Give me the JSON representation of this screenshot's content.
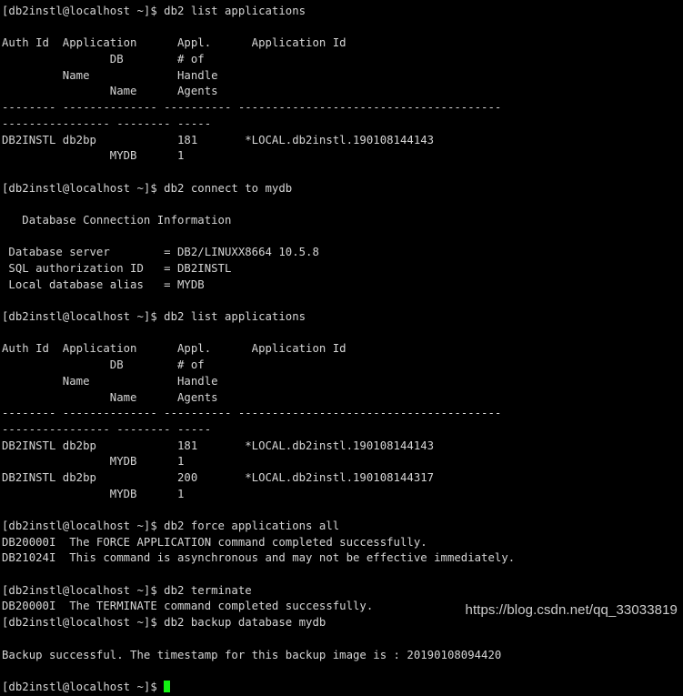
{
  "terminal": {
    "background_color": "#000000",
    "text_color": "#d6d6d6",
    "cursor_color": "#12f312",
    "prompt": "[db2instl@localhost ~]$ ",
    "lines": [
      "[db2instl@localhost ~]$ db2 list applications",
      "",
      "Auth Id  Application      Appl.      Application Id",
      "                DB        # of",
      "         Name             Handle",
      "                Name      Agents",
      "-------- -------------- ---------- ---------------------------------------",
      "---------------- -------- -----",
      "DB2INSTL db2bp            181       *LOCAL.db2instl.190108144143",
      "                MYDB      1",
      "",
      "[db2instl@localhost ~]$ db2 connect to mydb",
      "",
      "   Database Connection Information",
      "",
      " Database server        = DB2/LINUXX8664 10.5.8",
      " SQL authorization ID   = DB2INSTL",
      " Local database alias   = MYDB",
      "",
      "[db2instl@localhost ~]$ db2 list applications",
      "",
      "Auth Id  Application      Appl.      Application Id",
      "                DB        # of",
      "         Name             Handle",
      "                Name      Agents",
      "-------- -------------- ---------- ---------------------------------------",
      "---------------- -------- -----",
      "DB2INSTL db2bp            181       *LOCAL.db2instl.190108144143",
      "                MYDB      1",
      "DB2INSTL db2bp            200       *LOCAL.db2instl.190108144317",
      "                MYDB      1",
      "",
      "[db2instl@localhost ~]$ db2 force applications all",
      "DB20000I  The FORCE APPLICATION command completed successfully.",
      "DB21024I  This command is asynchronous and may not be effective immediately.",
      "",
      "[db2instl@localhost ~]$ db2 terminate",
      "DB20000I  The TERMINATE command completed successfully.",
      "[db2instl@localhost ~]$ db2 backup database mydb",
      "",
      "Backup successful. The timestamp for this backup image is : 20190108094420",
      ""
    ],
    "final_prompt": "[db2instl@localhost ~]$ "
  },
  "watermark": {
    "text": "https://blog.csdn.net/qq_33033819"
  }
}
